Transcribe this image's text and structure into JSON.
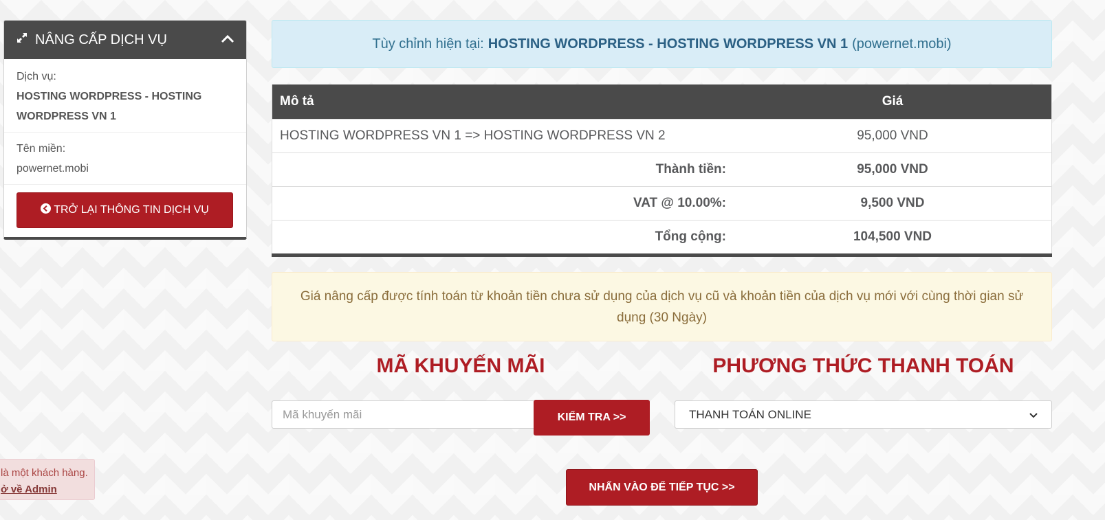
{
  "sidebar": {
    "title": "NÂNG CẤP DỊCH VỤ",
    "service_label": "Dịch vụ:",
    "service_value": "HOSTING WORDPRESS - HOSTING WORDPRESS VN 1",
    "domain_label": "Tên miền:",
    "domain_value": "powernet.mobi",
    "back_button": "TRỞ LẠI THÔNG TIN DỊCH VỤ"
  },
  "info": {
    "prefix": "Tùy chỉnh hiện tại:",
    "product": "HOSTING WORDPRESS - HOSTING WORDPRESS VN 1",
    "domain": "(powernet.mobi)"
  },
  "table": {
    "headers": {
      "description": "Mô tả",
      "price": "Giá"
    },
    "item": {
      "description": "HOSTING WORDPRESS VN 1 => HOSTING WORDPRESS VN 2",
      "price": "95,000 VND"
    },
    "subtotal": {
      "label": "Thành tiền:",
      "value": "95,000 VND"
    },
    "vat": {
      "label": "VAT @ 10.00%:",
      "value": "9,500 VND"
    },
    "total": {
      "label": "Tổng cộng:",
      "value": "104,500 VND"
    }
  },
  "notice": "Giá nâng cấp được tính toán từ khoản tiền chưa sử dụng của dịch vụ cũ và khoản tiền của dịch vụ mới với cùng thời gian sử dụng (30 Ngày)",
  "promo": {
    "title": "MÃ KHUYẾN MÃI",
    "placeholder": "Mã khuyến mãi",
    "button": "KIỂM TRA >>"
  },
  "payment": {
    "title": "PHƯƠNG THỨC THANH TOÁN",
    "selected": "THANH TOÁN ONLINE"
  },
  "continue_button": "NHẤN VÀO ĐỂ TIẾP TỤC >>",
  "admin_note": {
    "text": "là một khách hàng.",
    "link": "ở về Admin"
  },
  "colors": {
    "brand_red": "#ae1d24",
    "header_dark": "#4a4a4a",
    "info_bg": "#d9edf7",
    "warning_bg": "#fcf8e3"
  }
}
